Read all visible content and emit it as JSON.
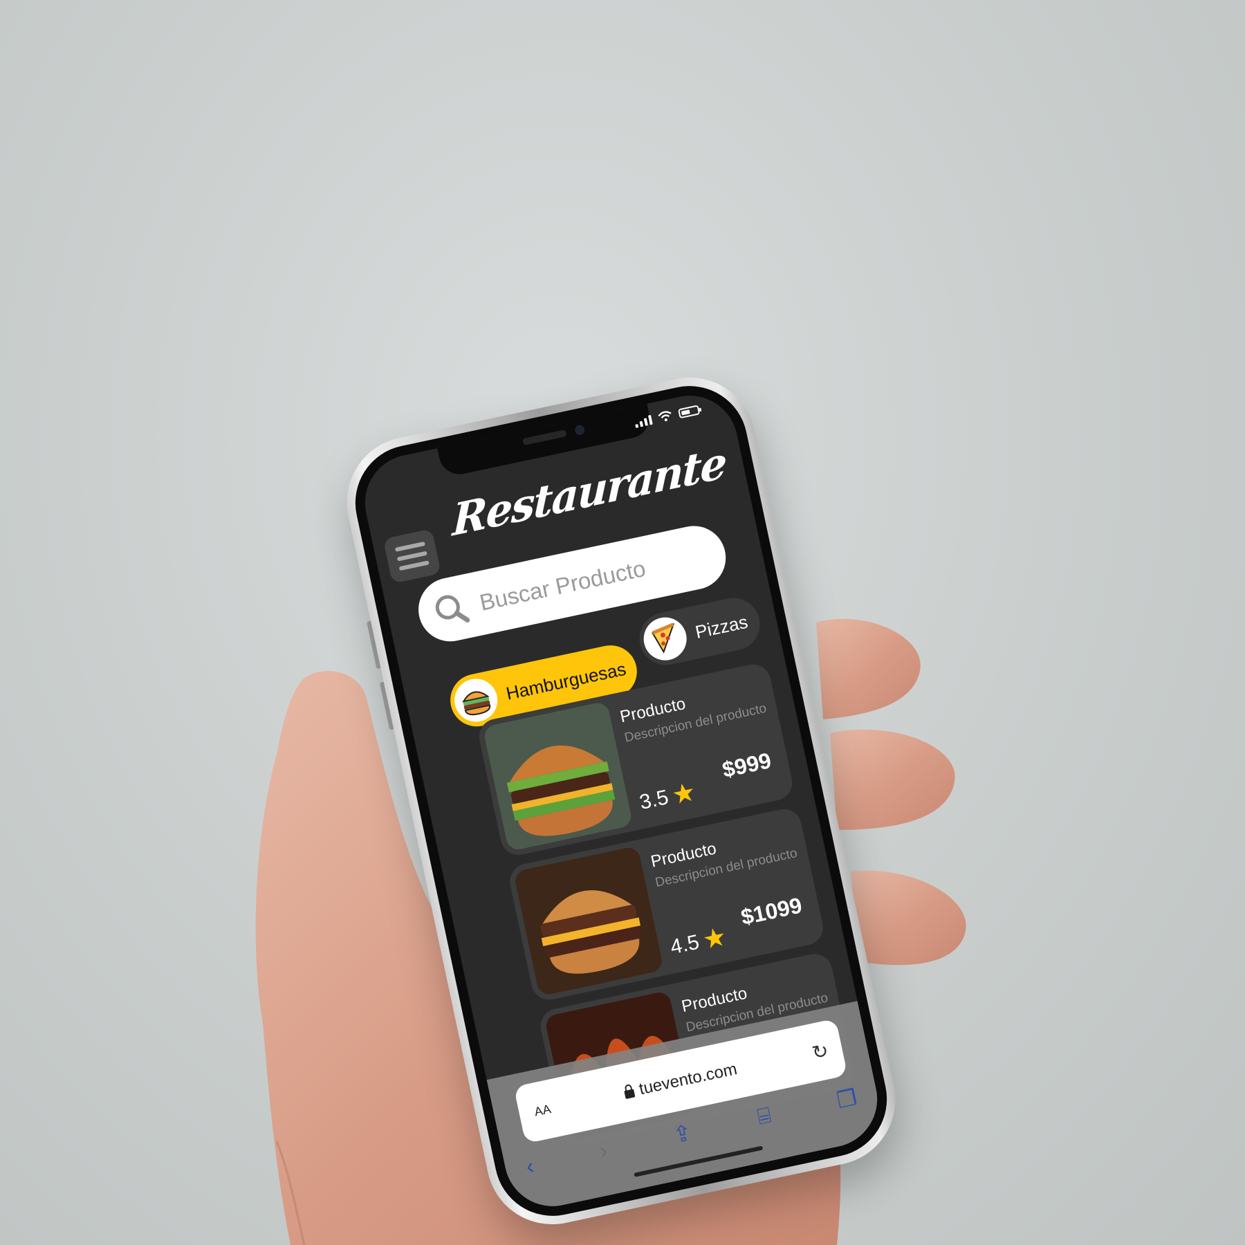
{
  "status_bar": {
    "signal_icon": "signal-bars-icon",
    "wifi_icon": "wifi-icon",
    "battery_icon": "battery-icon"
  },
  "app": {
    "title": "Restaurante",
    "menu_icon": "hamburger-menu-icon",
    "accent_color": "#ffc50a",
    "background_color": "#2a2a2a"
  },
  "search": {
    "placeholder": "Buscar Producto",
    "value": ""
  },
  "categories": [
    {
      "label": "Hamburguesas",
      "icon": "burger-icon",
      "selected": true
    },
    {
      "label": "Pizzas",
      "icon": "pizza-slice-icon",
      "selected": false
    }
  ],
  "products": [
    {
      "name": "Producto",
      "description": "Descripcion del producto",
      "rating": "3.5",
      "price": "$999"
    },
    {
      "name": "Producto",
      "description": "Descripcion del producto",
      "rating": "4.5",
      "price": "$1099"
    },
    {
      "name": "Producto",
      "description": "Descripcion del producto",
      "rating": "",
      "price": ""
    }
  ],
  "browser": {
    "text_size_label": "AA",
    "url": "tuevento.com",
    "reload_icon": "reload-icon",
    "toolbar": [
      "back-icon",
      "forward-icon",
      "share-icon",
      "bookmarks-icon",
      "tabs-icon"
    ]
  }
}
